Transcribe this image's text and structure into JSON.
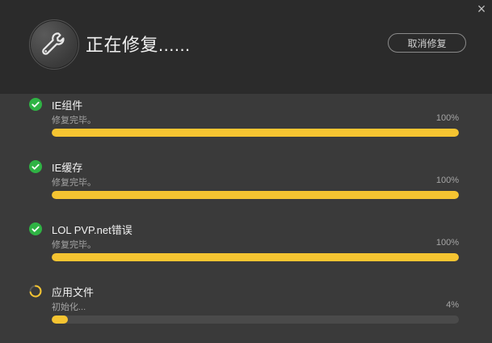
{
  "header": {
    "title": "正在修复......",
    "cancel_label": "取消修复",
    "close_icon": "×"
  },
  "colors": {
    "accent": "#f5c431",
    "success": "#2fb344",
    "header_bg": "#2b2b2b",
    "body_bg": "#3a3a3a"
  },
  "items": [
    {
      "name": "IE组件",
      "status": "修复完毕。",
      "percent_label": "100%",
      "progress": 1.0,
      "state": "done",
      "icon": "check-circle-icon"
    },
    {
      "name": "IE缓存",
      "status": "修复完毕。",
      "percent_label": "100%",
      "progress": 1.0,
      "state": "done",
      "icon": "check-circle-icon"
    },
    {
      "name": "LOL PVP.net错误",
      "status": "修复完毕。",
      "percent_label": "100%",
      "progress": 1.0,
      "state": "done",
      "icon": "check-circle-icon"
    },
    {
      "name": "应用文件",
      "status": "初始化...",
      "percent_label": "4%",
      "progress": 0.04,
      "state": "loading",
      "icon": "spinner-icon"
    }
  ]
}
